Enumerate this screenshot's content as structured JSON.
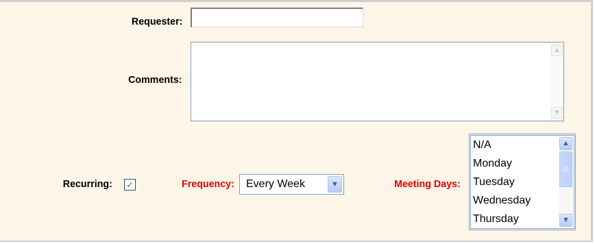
{
  "form": {
    "requester": {
      "label": "Requester:",
      "value": ""
    },
    "comments": {
      "label": "Comments:",
      "value": ""
    },
    "recurring": {
      "label": "Recurring:",
      "checked": true
    },
    "frequency": {
      "label": "Frequency:",
      "selected": "Every Week",
      "label_color": "#e00000"
    },
    "meeting_days": {
      "label": "Meeting Days:",
      "label_color": "#e00000",
      "options": [
        "N/A",
        "Monday",
        "Tuesday",
        "Wednesday",
        "Thursday"
      ]
    }
  },
  "icons": {
    "scroll_up": "▲",
    "scroll_down": "▼",
    "dropdown": "▼",
    "check": "✓"
  },
  "colors": {
    "panel_background": "#fdf5e8",
    "input_border": "#7f9db9",
    "required_label": "#e00000"
  }
}
